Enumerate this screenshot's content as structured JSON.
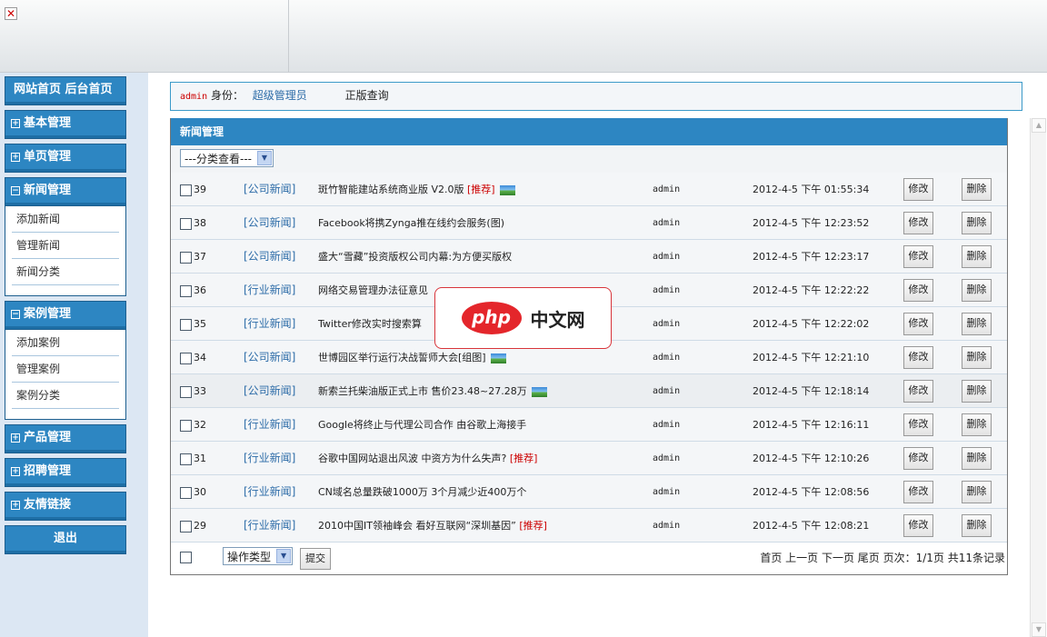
{
  "header": {
    "close_icon": "close-icon"
  },
  "user": {
    "name": "admin",
    "role_label": "身份：",
    "role": "超级管理员",
    "check": "正版查询"
  },
  "sidebar": {
    "home": "网站首页 后台首页",
    "groups": [
      {
        "label": "基本管理",
        "expanded": false
      },
      {
        "label": "单页管理",
        "expanded": false
      },
      {
        "label": "新闻管理",
        "expanded": true,
        "items": [
          "添加新闻",
          "管理新闻",
          "新闻分类"
        ]
      },
      {
        "label": "案例管理",
        "expanded": true,
        "items": [
          "添加案例",
          "管理案例",
          "案例分类"
        ]
      },
      {
        "label": "产品管理",
        "expanded": false
      },
      {
        "label": "招聘管理",
        "expanded": false
      },
      {
        "label": "友情链接",
        "expanded": false
      }
    ],
    "logout": "退出",
    "plus": "⊞",
    "minus": "⊟"
  },
  "panel": {
    "title": "新闻管理",
    "filter": "---分类查看---",
    "edit": "修改",
    "delete": "删除",
    "rec": "[推荐]",
    "rows": [
      {
        "id": "39",
        "cat": "[公司新闻]",
        "title": "斑竹智能建站系统商业版 V2.0版",
        "rec": true,
        "pic": true,
        "user": "admin",
        "time": "2012-4-5 下午 01:55:34"
      },
      {
        "id": "38",
        "cat": "[公司新闻]",
        "title": "Facebook将携Zynga推在线约会服务(图)",
        "rec": false,
        "pic": false,
        "user": "admin",
        "time": "2012-4-5 下午 12:23:52"
      },
      {
        "id": "37",
        "cat": "[公司新闻]",
        "title": "盛大“雪藏”投资版权公司内幕:为方便买版权",
        "rec": false,
        "pic": false,
        "user": "admin",
        "time": "2012-4-5 下午 12:23:17"
      },
      {
        "id": "36",
        "cat": "[行业新闻]",
        "title": "网络交易管理办法征意见",
        "rec": false,
        "pic": false,
        "user": "admin",
        "time": "2012-4-5 下午 12:22:22"
      },
      {
        "id": "35",
        "cat": "[行业新闻]",
        "title": "Twitter修改实时搜索算",
        "rec": false,
        "pic": false,
        "user": "admin",
        "time": "2012-4-5 下午 12:22:02"
      },
      {
        "id": "34",
        "cat": "[公司新闻]",
        "title": "世博园区举行运行决战誓师大会[组图]",
        "rec": false,
        "pic": true,
        "user": "admin",
        "time": "2012-4-5 下午 12:21:10"
      },
      {
        "id": "33",
        "cat": "[公司新闻]",
        "title": "新索兰托柴油版正式上市 售价23.48~27.28万",
        "rec": false,
        "pic": true,
        "user": "admin",
        "time": "2012-4-5 下午 12:18:14"
      },
      {
        "id": "32",
        "cat": "[行业新闻]",
        "title": "Google将终止与代理公司合作 由谷歌上海接手",
        "rec": false,
        "pic": false,
        "user": "admin",
        "time": "2012-4-5 下午 12:16:11"
      },
      {
        "id": "31",
        "cat": "[行业新闻]",
        "title": "谷歌中国网站退出风波 中资方为什么失声?",
        "rec": true,
        "pic": false,
        "user": "admin",
        "time": "2012-4-5 下午 12:10:26"
      },
      {
        "id": "30",
        "cat": "[行业新闻]",
        "title": "CN域名总量跌破1000万 3个月减少近400万个",
        "rec": false,
        "pic": false,
        "user": "admin",
        "time": "2012-4-5 下午 12:08:56"
      },
      {
        "id": "29",
        "cat": "[行业新闻]",
        "title": "2010中国IT领袖峰会 看好互联网“深圳基因”",
        "rec": true,
        "pic": false,
        "user": "admin",
        "time": "2012-4-5 下午 12:08:21"
      }
    ],
    "footer": {
      "op_type": "操作类型",
      "submit": "提交",
      "pager": "首页 上一页 下一页 尾页 页次：1/1页 共11条记录"
    }
  },
  "watermark": {
    "logo": "php",
    "text": "中文网"
  }
}
